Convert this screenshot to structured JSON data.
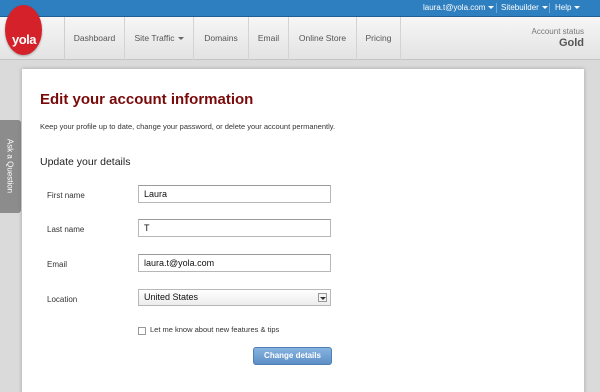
{
  "topbar": {
    "user_email": "laura.t@yola.com",
    "sitebuilder_label": "Sitebuilder",
    "help_label": "Help"
  },
  "logo": {
    "text": "yola"
  },
  "nav": {
    "items": [
      {
        "label": "Dashboard"
      },
      {
        "label": "Site Traffic"
      },
      {
        "label": "Domains"
      },
      {
        "label": "Email"
      },
      {
        "label": "Online Store"
      },
      {
        "label": "Pricing"
      }
    ],
    "account_status_label": "Account status",
    "account_status_value": "Gold"
  },
  "side_tab": {
    "label": "Ask a Question"
  },
  "page": {
    "title": "Edit your account information",
    "description": "Keep your profile up to date, change your password, or delete your account permanently.",
    "section_title": "Update your details"
  },
  "form": {
    "first_name": {
      "label": "First name",
      "value": "Laura"
    },
    "last_name": {
      "label": "Last name",
      "value": "T"
    },
    "email": {
      "label": "Email",
      "value": "laura.t@yola.com"
    },
    "location": {
      "label": "Location",
      "value": "United States"
    },
    "newsletter_label": "Let me know about new features & tips",
    "newsletter_checked": false,
    "submit_label": "Change details"
  },
  "colors": {
    "topbar": "#2e7fbf",
    "logo": "#d5222a",
    "title": "#7a0a0a",
    "button": "#6b9bd0"
  }
}
